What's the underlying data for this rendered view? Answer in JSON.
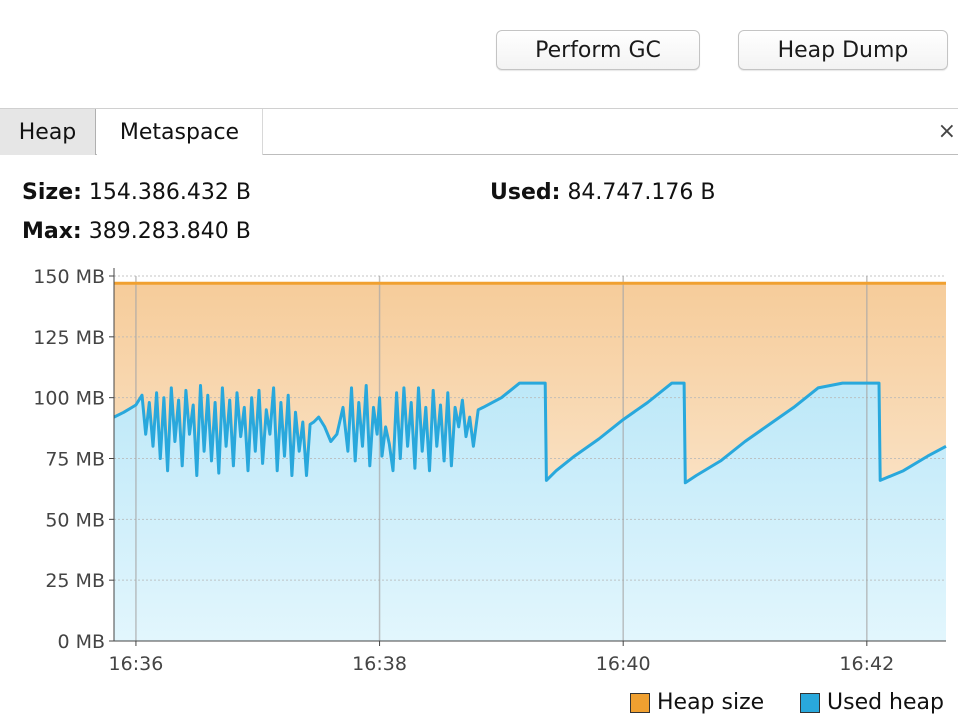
{
  "toolbar": {
    "perform_gc_label": "Perform GC",
    "heap_dump_label": "Heap Dump"
  },
  "tabs": [
    {
      "label": "Heap",
      "selected": true
    },
    {
      "label": "Metaspace",
      "selected": false
    }
  ],
  "close_glyph": "×",
  "stats": {
    "size_label": "Size:",
    "size_value": "154.386.432 B",
    "max_label": "Max:",
    "max_value": "389.283.840 B",
    "used_label": "Used:",
    "used_value": "84.747.176 B"
  },
  "chart_data": {
    "type": "area",
    "y_unit": "MB",
    "ylim": [
      0,
      150
    ],
    "y_ticks": [
      0,
      25,
      50,
      75,
      100,
      125,
      150
    ],
    "y_tick_labels": [
      "0 MB",
      "25 MB",
      "50 MB",
      "75 MB",
      "100 MB",
      "125 MB",
      "150 MB"
    ],
    "x_ticks": [
      "16:36",
      "16:38",
      "16:40",
      "16:42"
    ],
    "x_tick_minutes": [
      0,
      2,
      4,
      6
    ],
    "xlim_minutes": [
      -0.18,
      6.65
    ],
    "grid": true,
    "legend_position": "bottom-right",
    "colors": {
      "heap_size": "#f0a030",
      "heap_size_fill": "#f6cc9a",
      "used_heap": "#29a8dc",
      "used_heap_fill": "#bde8f8"
    },
    "series": [
      {
        "name": "Heap size",
        "x": [
          -0.18,
          6.65
        ],
        "y": [
          147,
          147
        ]
      },
      {
        "name": "Used heap",
        "x": [
          -0.18,
          -0.1,
          0.0,
          0.05,
          0.08,
          0.11,
          0.14,
          0.17,
          0.2,
          0.23,
          0.26,
          0.29,
          0.32,
          0.35,
          0.38,
          0.41,
          0.44,
          0.47,
          0.5,
          0.53,
          0.56,
          0.59,
          0.62,
          0.65,
          0.68,
          0.71,
          0.74,
          0.77,
          0.8,
          0.83,
          0.86,
          0.89,
          0.92,
          0.95,
          0.98,
          1.01,
          1.04,
          1.07,
          1.1,
          1.13,
          1.16,
          1.19,
          1.22,
          1.25,
          1.28,
          1.31,
          1.34,
          1.37,
          1.4,
          1.43,
          1.46,
          1.5,
          1.55,
          1.6,
          1.65,
          1.7,
          1.74,
          1.77,
          1.8,
          1.83,
          1.86,
          1.89,
          1.92,
          1.95,
          1.98,
          2.0,
          2.02,
          2.05,
          2.08,
          2.11,
          2.14,
          2.17,
          2.2,
          2.23,
          2.26,
          2.29,
          2.32,
          2.35,
          2.38,
          2.41,
          2.44,
          2.47,
          2.5,
          2.53,
          2.56,
          2.59,
          2.62,
          2.65,
          2.68,
          2.71,
          2.74,
          2.77,
          2.81,
          2.85,
          3.0,
          3.15,
          3.36,
          3.37,
          3.45,
          3.6,
          3.8,
          4.0,
          4.2,
          4.4,
          4.5,
          4.51,
          4.6,
          4.8,
          5.0,
          5.2,
          5.4,
          5.6,
          5.8,
          6.1,
          6.11,
          6.3,
          6.5,
          6.65
        ],
        "y": [
          92,
          94,
          97,
          101,
          85,
          98,
          80,
          102,
          75,
          100,
          70,
          104,
          82,
          99,
          72,
          103,
          85,
          97,
          68,
          105,
          78,
          101,
          74,
          98,
          69,
          104,
          80,
          99,
          72,
          102,
          84,
          96,
          70,
          100,
          78,
          103,
          73,
          95,
          85,
          104,
          70,
          98,
          76,
          101,
          68,
          94,
          78,
          90,
          68,
          89,
          90,
          92,
          88,
          82,
          85,
          96,
          78,
          104,
          74,
          98,
          80,
          105,
          72,
          96,
          85,
          100,
          76,
          88,
          81,
          70,
          102,
          75,
          104,
          80,
          98,
          71,
          104,
          78,
          96,
          70,
          103,
          80,
          97,
          74,
          102,
          72,
          96,
          88,
          99,
          84,
          92,
          80,
          95,
          96,
          100,
          106,
          106,
          66,
          70,
          76,
          83,
          91,
          98,
          106,
          106,
          65,
          68,
          74,
          82,
          89,
          96,
          104,
          106,
          106,
          66,
          70,
          76,
          80
        ]
      }
    ]
  }
}
